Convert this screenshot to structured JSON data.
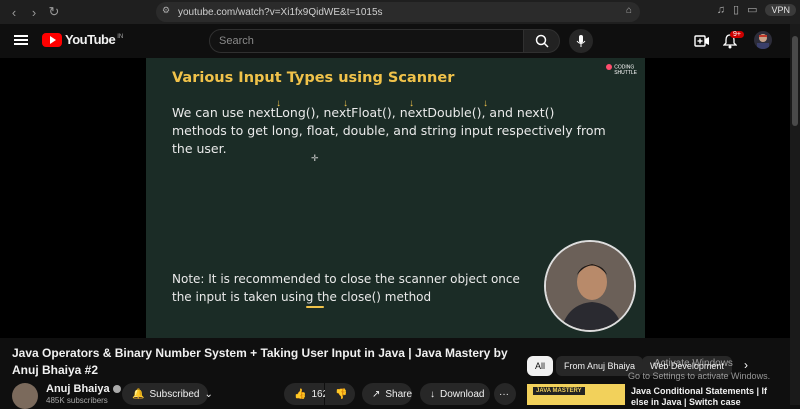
{
  "browser": {
    "url": "youtube.com/watch?v=Xi1fx9QidWE&t=1015s",
    "vpn_label": "VPN"
  },
  "header": {
    "logo_text": "YouTube",
    "logo_region": "IN",
    "search_placeholder": "Search",
    "notification_count": "9+"
  },
  "video": {
    "slide_title": "Various Input Types using Scanner",
    "brand_line1": "CODING",
    "brand_line2": "SHUTTLE",
    "paragraph": "We can use nextLong(), nextFloat(), nextDouble(), and next() methods to get long, float, double, and string input respectively from the user.",
    "note": "Note: It is recommended to close the scanner object once the input is taken using the close() method"
  },
  "details": {
    "title": "Java Operators & Binary Number System + Taking User Input in Java | Java Mastery by Anuj Bhaiya #2",
    "channel_name": "Anuj Bhaiya",
    "subscribers": "485K subscribers",
    "subscribed_label": "Subscribed",
    "like_count": "162",
    "share_label": "Share",
    "download_label": "Download",
    "more_label": "···"
  },
  "sidebar": {
    "chips": [
      "All",
      "From Anuj Bhaiya",
      "Web Development"
    ],
    "watermark_line1": "Activate Windows",
    "watermark_line2": "Go to Settings to activate Windows.",
    "rec_thumb_label": "JAVA MASTERY",
    "rec_title": "Java Conditional Statements | If else in Java | Switch case"
  },
  "colors": {
    "slide_bg": "#1b2c26",
    "slide_title": "#f0c24a",
    "accent_red": "#ff0000"
  }
}
